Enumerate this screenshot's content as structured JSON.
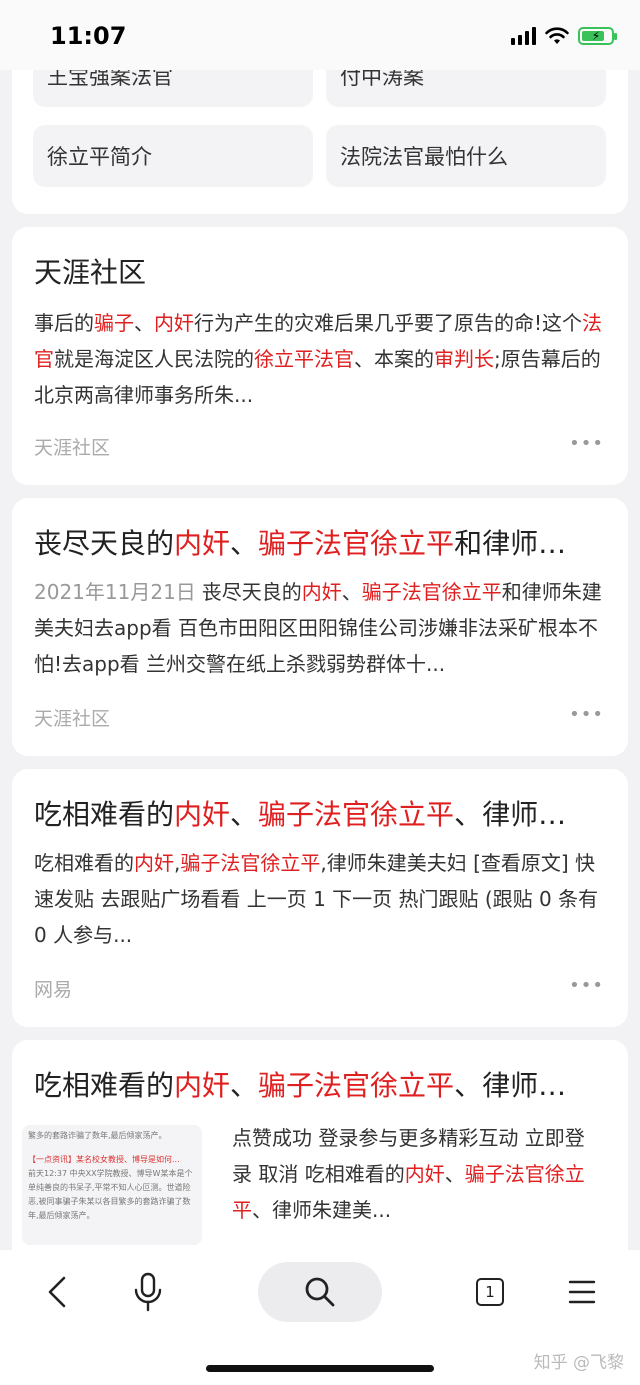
{
  "status": {
    "time": "11:07"
  },
  "related": [
    {
      "label": "王宝强案法官"
    },
    {
      "label": "付中涛案"
    },
    {
      "label": "徐立平简介"
    },
    {
      "label": "法院法官最怕什么"
    }
  ],
  "results": [
    {
      "title": [
        {
          "t": "天涯社区",
          "hl": false
        }
      ],
      "date": "",
      "body": [
        {
          "t": "事后的",
          "hl": false
        },
        {
          "t": "骗子",
          "hl": true
        },
        {
          "t": "、",
          "hl": false
        },
        {
          "t": "内奸",
          "hl": true
        },
        {
          "t": "行为产生的灾难后果几乎要了原告的命!这个",
          "hl": false
        },
        {
          "t": "法官",
          "hl": true
        },
        {
          "t": "就是海淀区人民法院的",
          "hl": false
        },
        {
          "t": "徐立平法官",
          "hl": true
        },
        {
          "t": "、本案的",
          "hl": false
        },
        {
          "t": "审判长",
          "hl": true
        },
        {
          "t": ";原告幕后的北京两高律师事务所朱...",
          "hl": false
        }
      ],
      "source": "天涯社区"
    },
    {
      "title": [
        {
          "t": "丧尽天良的",
          "hl": false
        },
        {
          "t": "内奸",
          "hl": true
        },
        {
          "t": "、",
          "hl": false
        },
        {
          "t": "骗子法官徐立平",
          "hl": true
        },
        {
          "t": "和律师…",
          "hl": false
        }
      ],
      "date": "2021年11月21日",
      "body": [
        {
          "t": "丧尽天良的",
          "hl": false
        },
        {
          "t": "内奸",
          "hl": true
        },
        {
          "t": "、",
          "hl": false
        },
        {
          "t": "骗子法官徐立平",
          "hl": true
        },
        {
          "t": "和律师朱建美夫妇去app看 百色市田阳区田阳锦佳公司涉嫌非法采矿根本不怕!去app看 兰州交警在纸上杀戮弱势群体十...",
          "hl": false
        }
      ],
      "source": "天涯社区"
    },
    {
      "title": [
        {
          "t": "吃相难看的",
          "hl": false
        },
        {
          "t": "内奸",
          "hl": true
        },
        {
          "t": "、",
          "hl": false
        },
        {
          "t": "骗子法官徐立平",
          "hl": true
        },
        {
          "t": "、律师…",
          "hl": false
        }
      ],
      "date": "",
      "body": [
        {
          "t": "吃相难看的",
          "hl": false
        },
        {
          "t": "内奸",
          "hl": true
        },
        {
          "t": ",",
          "hl": false
        },
        {
          "t": "骗子法官徐立平",
          "hl": true
        },
        {
          "t": ",律师朱建美夫妇 [查看原文] 快速发贴 去跟贴广场看看 上一页 1 下一页 热门跟贴 (跟贴 0 条有 0 人参与...",
          "hl": false
        }
      ],
      "source": "网易"
    },
    {
      "title": [
        {
          "t": "吃相难看的",
          "hl": false
        },
        {
          "t": "内奸",
          "hl": true
        },
        {
          "t": "、",
          "hl": false
        },
        {
          "t": "骗子法官徐立平",
          "hl": true
        },
        {
          "t": "、律师…",
          "hl": false
        }
      ],
      "date": "",
      "body": [
        {
          "t": "点赞成功 登录参与更多精彩互动 立即登录 取消 吃相难看的",
          "hl": false
        },
        {
          "t": "内奸",
          "hl": true
        },
        {
          "t": "、",
          "hl": false
        },
        {
          "t": "骗子法官徐立平",
          "hl": true
        },
        {
          "t": "、律师朱建美...",
          "hl": false
        }
      ],
      "source": "",
      "thumb_lines": [
        "繁多的套路诈骗了数年,最后倾家荡产。",
        "【一点资讯】某名校女教授、博导是如何...",
        "前天12:37 中央XX学院教授、博导W某本是个单纯善良的书呆子,平常不知人心叵测。世道险恶,被同事骗子朱某以各目繁多的套路诈骗了数年,最后倾家荡产。"
      ]
    }
  ],
  "more_icon": "more-dots-icon",
  "tabs_count": "1",
  "watermark": "知乎 @飞黎",
  "colors": {
    "highlight": "#e02020",
    "source": "#aaaaaa",
    "background": "#f2f2f4"
  }
}
